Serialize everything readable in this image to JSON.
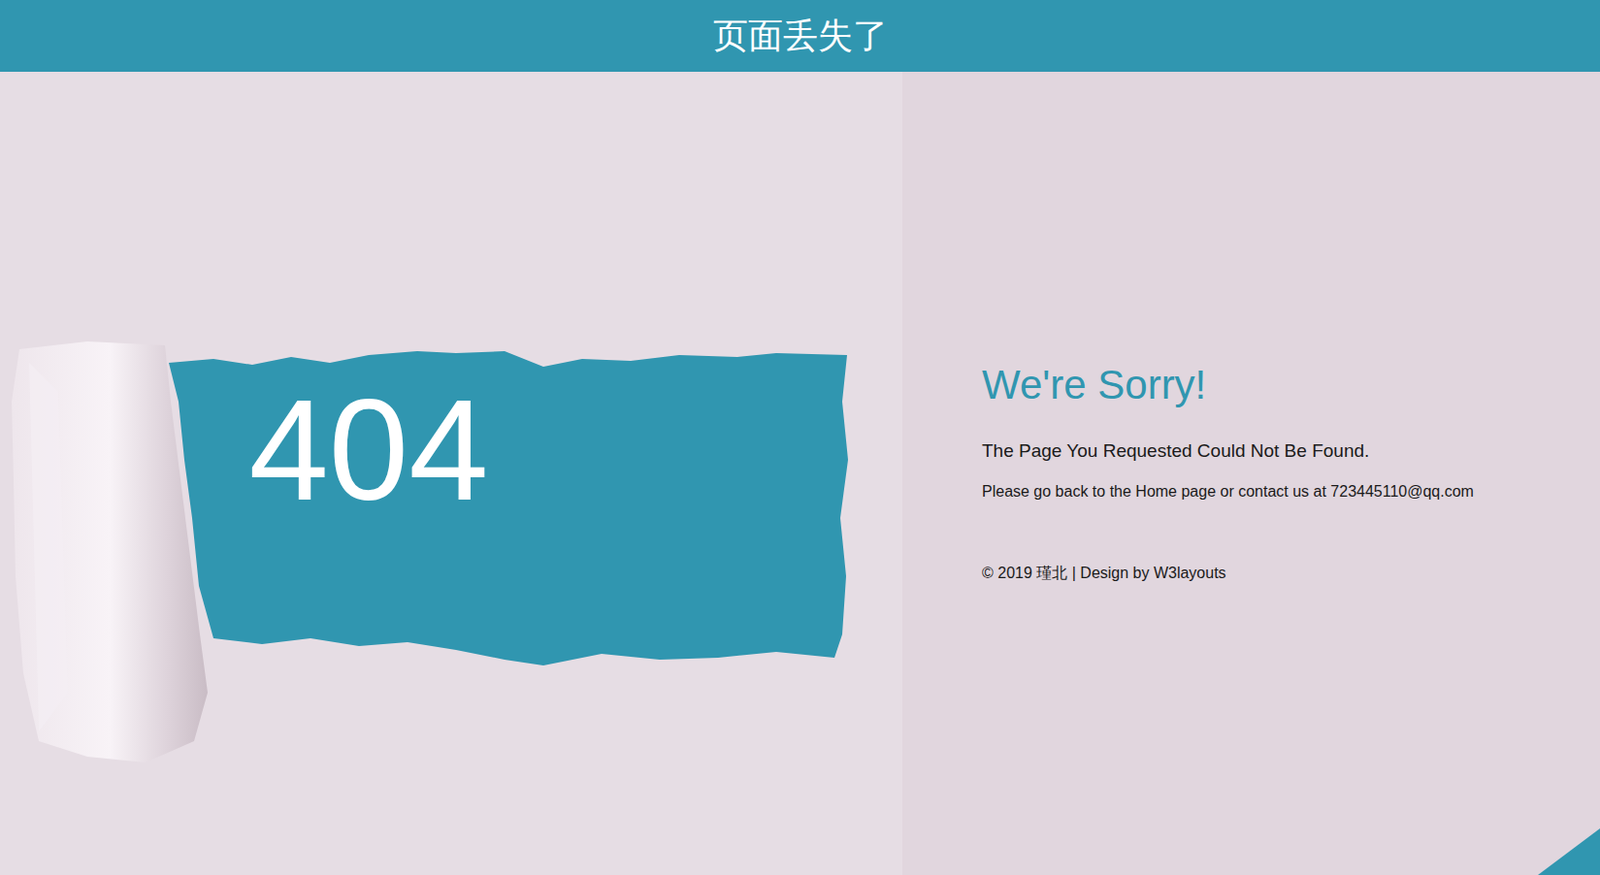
{
  "header": {
    "title": "页面丢失了"
  },
  "hero": {
    "code": "404"
  },
  "message": {
    "heading": "We're Sorry!",
    "subheading": "The Page You Requested Could Not Be Found.",
    "body": "Please go back to the Home page or contact us at 723445110@qq.com"
  },
  "footer": {
    "text": "© 2019 瑾北 | Design by W3layouts"
  }
}
